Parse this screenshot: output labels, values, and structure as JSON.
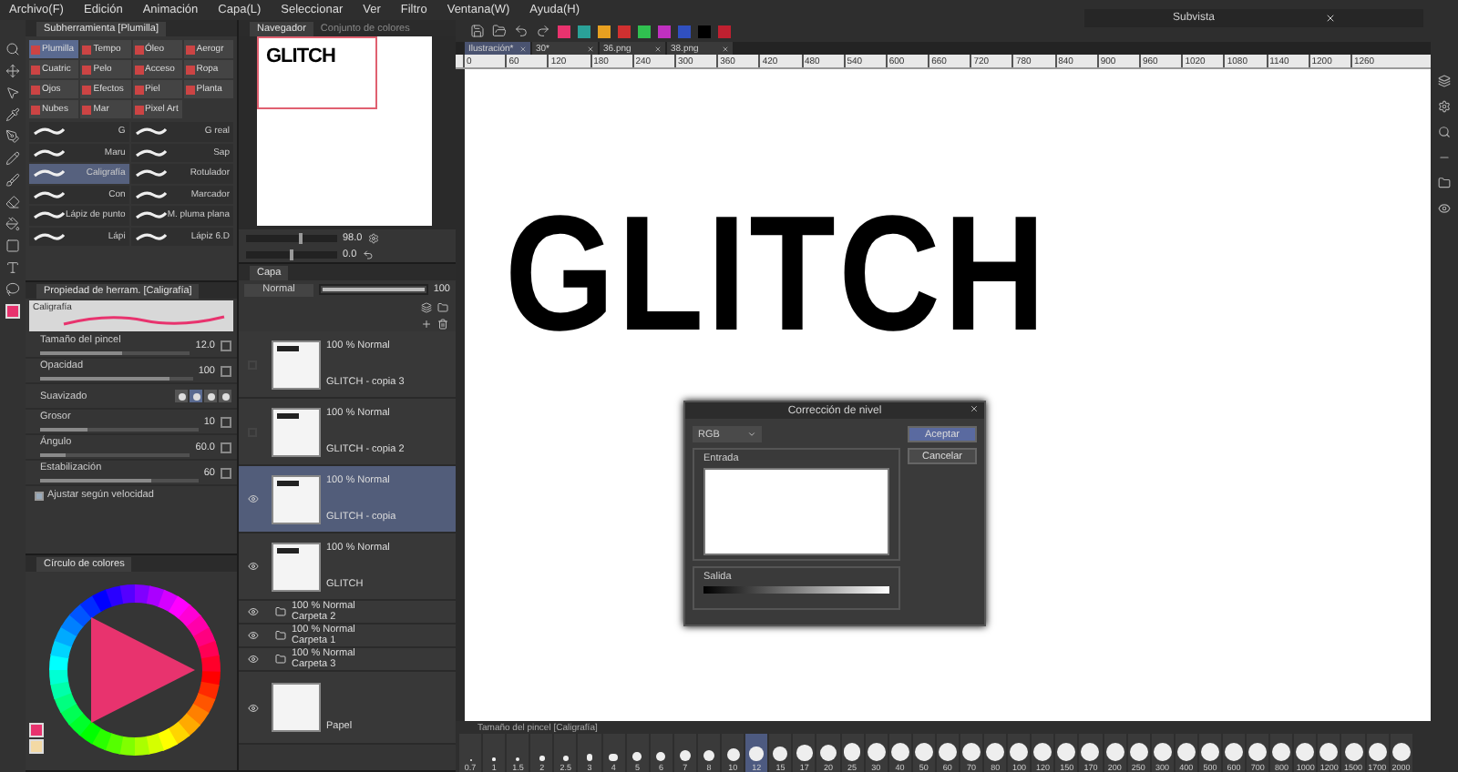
{
  "menu": [
    "Archivo(F)",
    "Edición",
    "Animación",
    "Capa(L)",
    "Seleccionar",
    "Ver",
    "Filtro",
    "Ventana(W)",
    "Ayuda(H)"
  ],
  "subtool_panel": {
    "title": "Subherramienta [Plumilla]",
    "groups": [
      {
        "label": "Plumilla",
        "selected": true
      },
      {
        "label": "Tempo",
        "selected": false
      },
      {
        "label": "Óleo",
        "selected": false
      },
      {
        "label": "Aerogr",
        "selected": false
      },
      {
        "label": "Cuatric",
        "selected": false
      },
      {
        "label": "Pelo",
        "selected": false
      },
      {
        "label": "Acceso",
        "selected": false
      },
      {
        "label": "Ropa",
        "selected": false
      },
      {
        "label": "Ojos",
        "selected": false
      },
      {
        "label": "Efectos",
        "selected": false
      },
      {
        "label": "Piel",
        "selected": false
      },
      {
        "label": "Planta",
        "selected": false
      },
      {
        "label": "Nubes",
        "selected": false
      },
      {
        "label": "Mar",
        "selected": false
      },
      {
        "label": "Pixel Art",
        "selected": false
      }
    ],
    "brushes": [
      {
        "name": "G",
        "selected": false
      },
      {
        "name": "G real",
        "selected": false
      },
      {
        "name": "Maru",
        "selected": false
      },
      {
        "name": "Sap",
        "selected": false
      },
      {
        "name": "Caligrafía",
        "selected": true
      },
      {
        "name": "Rotulador",
        "selected": false
      },
      {
        "name": "Con",
        "selected": false
      },
      {
        "name": "Marcador",
        "selected": false
      },
      {
        "name": "Lápiz de punto",
        "selected": false
      },
      {
        "name": "M. pluma plana",
        "selected": false
      },
      {
        "name": "Lápi",
        "selected": false
      },
      {
        "name": "Lápiz 6.D",
        "selected": false
      }
    ]
  },
  "tool_property": {
    "title": "Propiedad de herram. [Caligrafía]",
    "preview_label": "Caligrafía",
    "rows": [
      {
        "kind": "slider",
        "label": "Tamaño del pincel",
        "value": "12.0",
        "level": 0.55
      },
      {
        "kind": "slider",
        "label": "Opacidad",
        "value": "100",
        "level": 0.85
      },
      {
        "kind": "shapes",
        "label": "Suavizado",
        "options": [
          {
            "selected": false
          },
          {
            "selected": true
          },
          {
            "selected": false
          },
          {
            "selected": false
          }
        ]
      },
      {
        "kind": "slider",
        "label": "Grosor",
        "value": "10",
        "level": 0.3
      },
      {
        "kind": "slider",
        "label": "Ángulo",
        "value": "60.0",
        "level": 0.17
      },
      {
        "kind": "slider",
        "label": "Estabilización",
        "value": "60",
        "level": 0.7
      },
      {
        "kind": "checkbox",
        "label": "Ajustar según velocidad",
        "checked": true
      }
    ]
  },
  "color_panel": {
    "title": "Círculo de colores"
  },
  "navigator": {
    "tabs": [
      {
        "label": "Navegador",
        "selected": true
      },
      {
        "label": "Conjunto de colores",
        "selected": false
      }
    ],
    "preview_text": "GLITCH",
    "zoom": "98.0",
    "zoom_slider": {
      "level": 0.6
    },
    "angle": "0.0",
    "angle_slider": {
      "level": 0.5
    }
  },
  "layers_panel": {
    "tab": "Capa",
    "blend_mode": "Normal",
    "opacity": "100",
    "opacity_slider": {
      "level": 1
    },
    "layers": [
      {
        "kind": "raster",
        "mode": "100 % Normal",
        "name": "GLITCH - copia 3",
        "visible": false,
        "selected": false
      },
      {
        "kind": "raster",
        "mode": "100 % Normal",
        "name": "GLITCH - copia 2",
        "visible": false,
        "selected": false
      },
      {
        "kind": "raster",
        "mode": "100 % Normal",
        "name": "GLITCH - copia",
        "visible": true,
        "selected": true
      },
      {
        "kind": "raster",
        "mode": "100 % Normal",
        "name": "GLITCH",
        "visible": true,
        "selected": false
      },
      {
        "kind": "folder",
        "mode": "100 % Normal",
        "name": "Carpeta 2",
        "visible": true,
        "selected": false
      },
      {
        "kind": "folder",
        "mode": "100 % Normal",
        "name": "Carpeta 1",
        "visible": true,
        "selected": false
      },
      {
        "kind": "folder",
        "mode": "100 % Normal",
        "name": "Carpeta 3",
        "visible": true,
        "selected": false
      },
      {
        "kind": "paper",
        "name": "Papel",
        "visible": true,
        "selected": false
      }
    ]
  },
  "canvas_tabs": [
    {
      "label": "Ilustración*",
      "selected": true
    },
    {
      "label": "30*",
      "selected": false
    },
    {
      "label": "36.png",
      "selected": false
    },
    {
      "label": "38.png",
      "selected": false
    }
  ],
  "ruler": [
    "0",
    "60",
    "120",
    "180",
    "240",
    "300",
    "360",
    "420",
    "480",
    "540",
    "600",
    "660",
    "720",
    "780",
    "840",
    "900",
    "960",
    "1020",
    "1080",
    "1140",
    "1200",
    "1260"
  ],
  "canvas_text": "GLITCH",
  "subview": {
    "title": "Subvista"
  },
  "level_dialog": {
    "title": "Corrección de nivel",
    "channel": "RGB",
    "input_label": "Entrada",
    "output_label": "Salida",
    "buttons": [
      "Aceptar",
      "Cancelar"
    ]
  },
  "brush_size_panel": {
    "title": "Tamaño del pincel [Caligrafía]",
    "sizes": [
      {
        "label": "0.7",
        "selected": false
      },
      {
        "label": "1",
        "selected": false
      },
      {
        "label": "1.5",
        "selected": false
      },
      {
        "label": "2",
        "selected": false
      },
      {
        "label": "2.5",
        "selected": false
      },
      {
        "label": "3",
        "selected": false
      },
      {
        "label": "4",
        "selected": false
      },
      {
        "label": "5",
        "selected": false
      },
      {
        "label": "6",
        "selected": false
      },
      {
        "label": "7",
        "selected": false
      },
      {
        "label": "8",
        "selected": false
      },
      {
        "label": "10",
        "selected": false
      },
      {
        "label": "12",
        "selected": true
      },
      {
        "label": "15",
        "selected": false
      },
      {
        "label": "17",
        "selected": false
      },
      {
        "label": "20",
        "selected": false
      },
      {
        "label": "25",
        "selected": false
      },
      {
        "label": "30",
        "selected": false
      },
      {
        "label": "40",
        "selected": false
      },
      {
        "label": "50",
        "selected": false
      },
      {
        "label": "60",
        "selected": false
      },
      {
        "label": "70",
        "selected": false
      },
      {
        "label": "80",
        "selected": false
      },
      {
        "label": "100",
        "selected": false
      },
      {
        "label": "120",
        "selected": false
      },
      {
        "label": "150",
        "selected": false
      },
      {
        "label": "170",
        "selected": false
      },
      {
        "label": "200",
        "selected": false
      },
      {
        "label": "250",
        "selected": false
      },
      {
        "label": "300",
        "selected": false
      },
      {
        "label": "400",
        "selected": false
      },
      {
        "label": "500",
        "selected": false
      },
      {
        "label": "600",
        "selected": false
      },
      {
        "label": "700",
        "selected": false
      },
      {
        "label": "800",
        "selected": false
      },
      {
        "label": "1000",
        "selected": false
      },
      {
        "label": "1200",
        "selected": false
      },
      {
        "label": "1500",
        "selected": false
      },
      {
        "label": "1700",
        "selected": false
      },
      {
        "label": "2000",
        "selected": false
      }
    ]
  }
}
